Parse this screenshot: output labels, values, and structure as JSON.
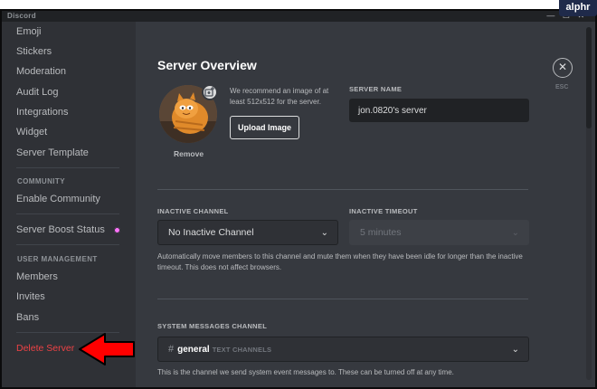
{
  "window": {
    "app_name": "Discord",
    "controls": [
      "—",
      "☐",
      "✕"
    ]
  },
  "sidebar": {
    "items": [
      {
        "label": "Emoji"
      },
      {
        "label": "Stickers"
      },
      {
        "label": "Moderation"
      },
      {
        "label": "Audit Log"
      },
      {
        "label": "Integrations"
      },
      {
        "label": "Widget"
      },
      {
        "label": "Server Template"
      }
    ],
    "community": {
      "header": "COMMUNITY",
      "items": [
        {
          "label": "Enable Community"
        }
      ]
    },
    "boost": {
      "label": "Server Boost Status",
      "badge_color": "#ff73fa"
    },
    "user_management": {
      "header": "USER MANAGEMENT",
      "items": [
        {
          "label": "Members"
        },
        {
          "label": "Invites"
        },
        {
          "label": "Bans"
        }
      ]
    },
    "delete": {
      "label": "Delete Server",
      "color": "#ed4245"
    }
  },
  "main": {
    "title": "Server Overview",
    "close": {
      "icon": "close-icon",
      "label": "ESC"
    },
    "icon_section": {
      "hint": "We recommend an image of at least 512x512 for the server.",
      "upload_button": "Upload Image",
      "remove": "Remove",
      "badge_icon": "add-image-icon"
    },
    "server_name": {
      "label": "SERVER NAME",
      "value": "jon.0820's server"
    },
    "inactive_channel": {
      "label": "INACTIVE CHANNEL",
      "value": "No Inactive Channel"
    },
    "inactive_timeout": {
      "label": "INACTIVE TIMEOUT",
      "value": "5 minutes"
    },
    "inactive_desc": "Automatically move members to this channel and mute them when they have been idle for longer than the inactive timeout. This does not affect browsers.",
    "system_messages": {
      "label": "SYSTEM MESSAGES CHANNEL",
      "hash": "#",
      "channel": "general",
      "category": "TEXT CHANNELS",
      "desc": "This is the channel we send system event messages to. These can be turned off at any time."
    }
  },
  "watermark": "alphr",
  "colors": {
    "background": "#36393f",
    "sidebar": "#2f3136",
    "accent": "#ffffff",
    "danger": "#ed4245",
    "annotation_arrow": "#ff0000"
  }
}
